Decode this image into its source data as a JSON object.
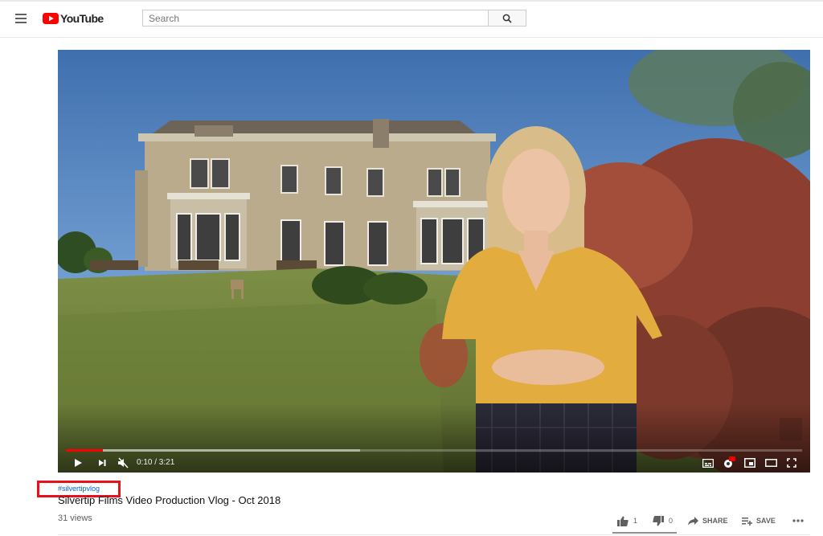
{
  "header": {
    "logo_text": "YouTube",
    "search_placeholder": "Search",
    "brand_color": "#ff0000"
  },
  "player": {
    "time_display": "0:10 / 3:21",
    "current_time": "0:10",
    "duration": "3:21",
    "progress_played_fraction": 0.05,
    "progress_buffered_fraction": 0.4,
    "progress_color": "#ff0000",
    "controls": [
      "play-icon",
      "next-icon",
      "muted-volume-icon",
      "subtitles-icon",
      "settings-hd-icon",
      "miniplayer-icon",
      "theater-mode-icon",
      "fullscreen-icon"
    ],
    "settings_badge": "HD"
  },
  "video_info": {
    "hashtag": "#silvertipvlog",
    "title": "Silvertip Films Video Production Vlog - Oct 2018",
    "views": "31 views"
  },
  "actions": {
    "likes": "1",
    "dislikes": "0",
    "share_label": "SHARE",
    "save_label": "SAVE",
    "more_icon": "more-horizontal-icon"
  },
  "annotation": {
    "highlight_color": "#e8101a"
  }
}
